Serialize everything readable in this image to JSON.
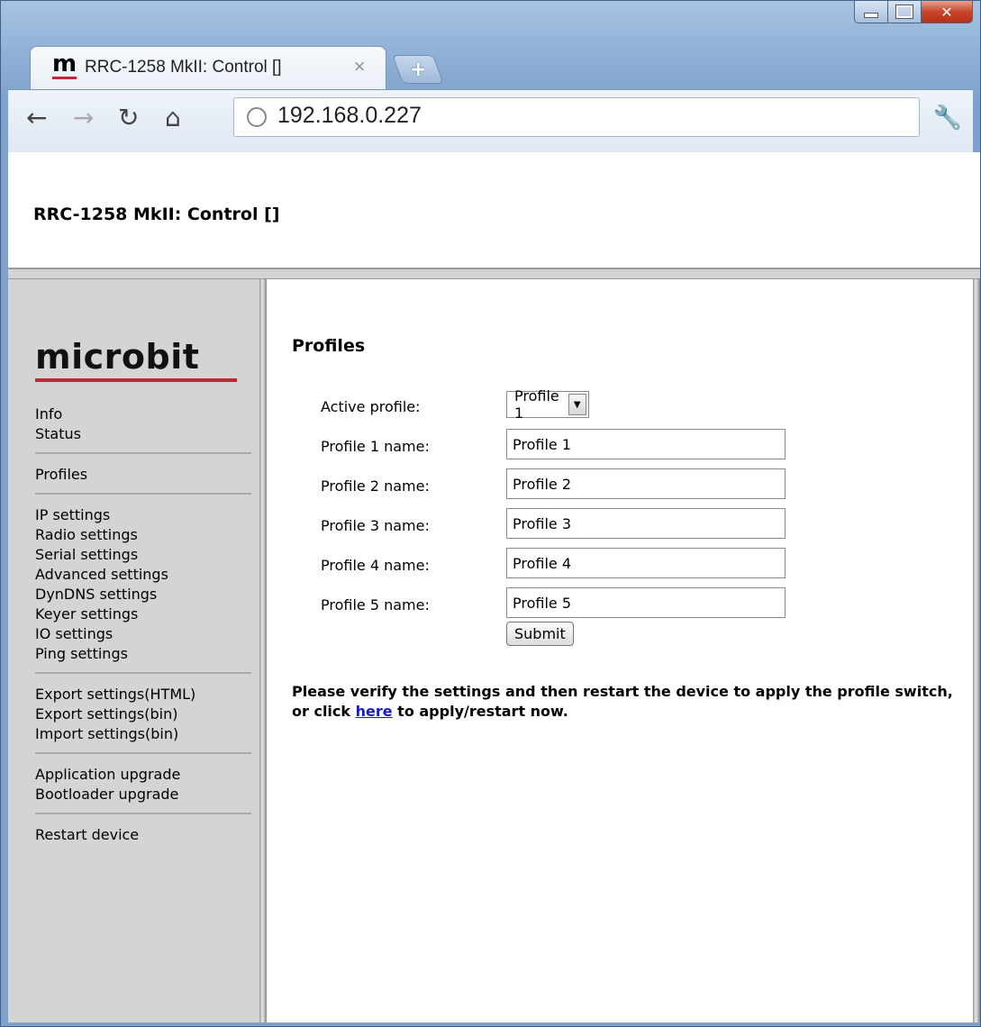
{
  "browser": {
    "tab_favicon": "m",
    "tab_title": "RRC-1258 MkII: Control []",
    "tab_close": "×",
    "new_tab": "+",
    "url": "192.168.0.227"
  },
  "header": {
    "title": "RRC-1258 MkII: Control []"
  },
  "sidebar": {
    "logo": "microbit",
    "groups": [
      [
        "Info",
        "Status"
      ],
      [
        "Profiles"
      ],
      [
        "IP settings",
        "Radio settings",
        "Serial settings",
        "Advanced settings",
        "DynDNS settings",
        "Keyer settings",
        "IO settings",
        "Ping settings"
      ],
      [
        "Export settings(HTML)",
        "Export settings(bin)",
        "Import settings(bin)"
      ],
      [
        "Application upgrade",
        "Bootloader upgrade"
      ],
      [
        "Restart device"
      ]
    ]
  },
  "main": {
    "heading": "Profiles",
    "active_profile_label": "Active profile:",
    "active_profile_value": "Profile 1",
    "profiles": [
      {
        "label": "Profile 1 name:",
        "value": "Profile 1"
      },
      {
        "label": "Profile 2 name:",
        "value": "Profile 2"
      },
      {
        "label": "Profile 3 name:",
        "value": "Profile 3"
      },
      {
        "label": "Profile 4 name:",
        "value": "Profile 4"
      },
      {
        "label": "Profile 5 name:",
        "value": "Profile 5"
      }
    ],
    "submit_label": "Submit",
    "note_before": "Please verify the settings and then restart the device to apply the profile switch, or click ",
    "note_link": "here",
    "note_after": " to apply/restart now."
  },
  "colors": {
    "logo_accent": "#c0283a",
    "link": "#1a1acc",
    "sidebar_bg": "#d4d4d4"
  }
}
